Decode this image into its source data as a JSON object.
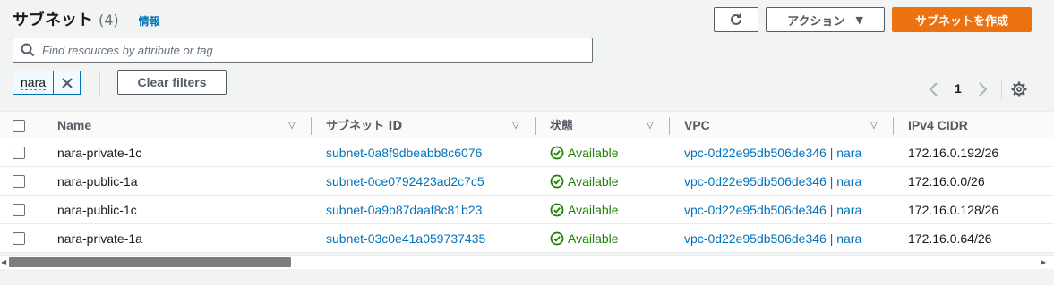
{
  "header": {
    "title": "サブネット",
    "count": "(4)",
    "info": "情報"
  },
  "toolbar": {
    "refresh_icon": "refresh-icon",
    "actions_label": "アクション",
    "create_label": "サブネットを作成"
  },
  "search": {
    "placeholder": "Find resources by attribute or tag",
    "value": ""
  },
  "filter": {
    "token": "nara",
    "clear_label": "Clear filters"
  },
  "pagination": {
    "page": "1"
  },
  "table": {
    "columns": [
      "Name",
      "サブネット ID",
      "状態",
      "VPC",
      "IPv4 CIDR"
    ],
    "rows": [
      {
        "name": "nara-private-1c",
        "subnet_id": "subnet-0a8f9dbeabb8c6076",
        "state": "Available",
        "vpc": "vpc-0d22e95db506de346 | nara",
        "cidr": "172.16.0.192/26"
      },
      {
        "name": "nara-public-1a",
        "subnet_id": "subnet-0ce0792423ad2c7c5",
        "state": "Available",
        "vpc": "vpc-0d22e95db506de346 | nara",
        "cidr": "172.16.0.0/26"
      },
      {
        "name": "nara-public-1c",
        "subnet_id": "subnet-0a9b87daaf8c81b23",
        "state": "Available",
        "vpc": "vpc-0d22e95db506de346 | nara",
        "cidr": "172.16.0.128/26"
      },
      {
        "name": "nara-private-1a",
        "subnet_id": "subnet-03c0e41a059737435",
        "state": "Available",
        "vpc": "vpc-0d22e95db506de346 | nara",
        "cidr": "172.16.0.64/26"
      }
    ]
  },
  "colors": {
    "accent": "#ec7211",
    "link": "#0073bb",
    "success": "#1d8102"
  }
}
